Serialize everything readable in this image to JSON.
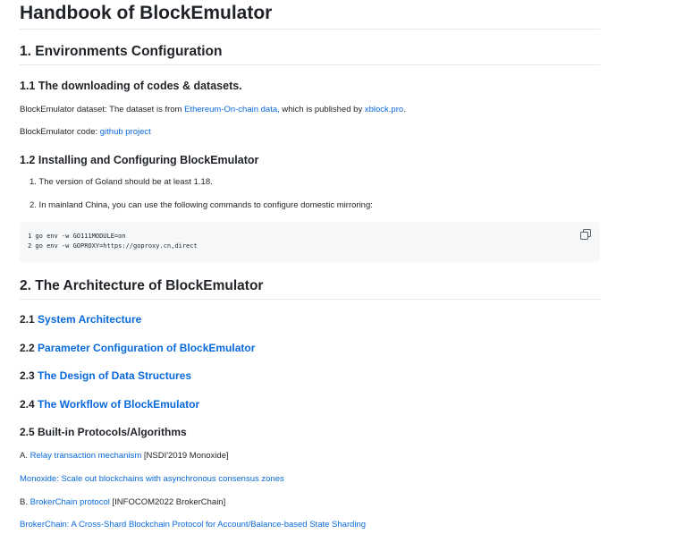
{
  "title": "Handbook of BlockEmulator",
  "section1": {
    "heading": "1. Environments Configuration",
    "sub1": {
      "heading": "1.1 The downloading of codes & datasets.",
      "dataset_prefix": "BlockEmulator dataset: The dataset is from ",
      "dataset_link": "Ethereum-On-chain data,",
      "dataset_mid": " which is published by ",
      "dataset_link2": "xblock.pro",
      "dataset_suffix": ".",
      "code_prefix": "BlockEmulator code: ",
      "code_link": "github project"
    },
    "sub2": {
      "heading": "1.2 Installing and Configuring BlockEmulator",
      "items": [
        "1. The version of Goland should be at least 1.18.",
        "2. In mainland China, you can use the following commands to configure domestic mirroring:"
      ],
      "code_lines": [
        "1 go env -w GO111MODULE=on",
        "2 go env -w GOPROXY=https://goproxy.cn,direct"
      ]
    }
  },
  "section2": {
    "heading": "2. The Architecture of BlockEmulator",
    "links": [
      {
        "num": "2.1 ",
        "text": "System Architecture"
      },
      {
        "num": "2.2 ",
        "text": "Parameter Configuration of BlockEmulator"
      },
      {
        "num": "2.3 ",
        "text": "The Design of Data Structures"
      },
      {
        "num": "2.4 ",
        "text": "The Workflow of BlockEmulator"
      }
    ],
    "sub5": {
      "heading": "2.5 Built-in Protocols/Algorithms",
      "a_prefix": "A. ",
      "a_link": "Relay transaction mechanism",
      "a_suffix": " [NSDI'2019 Monoxide]",
      "a_paper": "Monoxide: Scale out blockchains with asynchronous consensus zones",
      "b_prefix": "B. ",
      "b_link": "BrokerChain protocol",
      "b_suffix": " [INFOCOM2022 BrokerChain]",
      "b_paper": "BrokerChain: A Cross-Shard Blockchain Protocol for Account/Balance-based State Sharding"
    }
  },
  "colors": {
    "link": "#0969da",
    "text": "#1f2328",
    "code_bg": "#f6f8fa"
  },
  "icons": {
    "copy": "copy-icon"
  }
}
